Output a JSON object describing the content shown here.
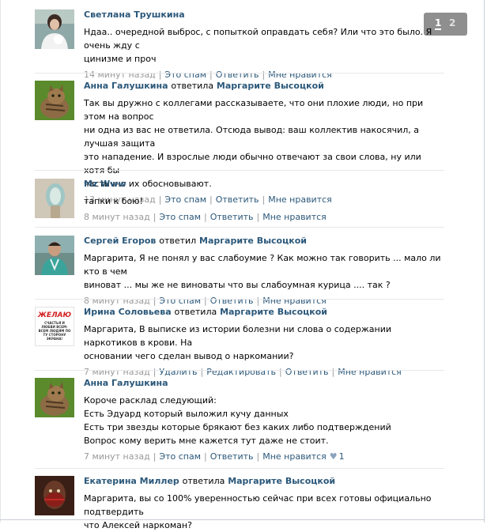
{
  "pagination": {
    "pages": [
      "1",
      "2"
    ],
    "current": "1"
  },
  "meta_links": {
    "spam": "Это спам",
    "reply": "Ответить",
    "like": "Мне нравится",
    "delete": "Удалить",
    "edit": "Редактировать"
  },
  "comments": [
    {
      "author": "Светлана Трушкина",
      "verb": "",
      "target": "",
      "lines": [
        "Ндаа.. очередной выброс, с попыткой оправдать себя? Или что это было. Я очень жду с",
        "цинизме и проч"
      ],
      "time": "14 минут назад",
      "likes": ""
    },
    {
      "author": "Анна Галушкина",
      "verb": "ответила",
      "target": "Маргарите Высоцкой",
      "lines": [
        "Так вы дружно с коллегами рассказываете, что они плохие люди, но при этом на вопрос",
        "ни одна из вас не ответила. Отсюда вывод: ваш коллектив накосячил, а лучшая защита",
        "это нападение. И взрослые люди обычно отвечают за свои слова, ну или хотя бы",
        "частично их обосновывают."
      ],
      "time": "13 минут назад",
      "likes": ""
    },
    {
      "author": "Mz Www",
      "verb": "",
      "target": "",
      "lines": [
        "тапки к бою!"
      ],
      "time": "8 минут назад",
      "likes": ""
    },
    {
      "author": "Сергей Егоров",
      "verb": "ответил",
      "target": "Маргарите Высоцкой",
      "lines": [
        "Маргарита, Я не понял у вас слабоумие ? Как можно так говорить ... мало ли кто в чем",
        "виноват ... мы же не виноваты что вы слабоумная курица .... так ?"
      ],
      "time": "8 минут назад",
      "likes": ""
    },
    {
      "author": "Ирина Соловьева",
      "verb": "ответила",
      "target": "Маргарите Высоцкой",
      "lines": [
        "Маргарита, В выписке из истории болезни ни слова о содержании наркотиков в крови. На",
        "основании чего сделан вывод о наркомании?"
      ],
      "time": "7 минут назад",
      "likes": "",
      "avatar_text": {
        "big": "ЖЕЛАЮ",
        "small": "СЧАСТЬЯ И ЛЮБВИ ВСЕМ-ВСЕМ ЛЮДЯМ ПО ТУ СТОРОНУ ЭКРАНА!"
      }
    },
    {
      "author": "Анна Галушкина",
      "verb": "",
      "target": "",
      "lines": [
        "Короче расклад следующий:",
        "Есть Эдуард который выложил кучу данных",
        "Есть три звезды которые брякают без каких либо подтверждений",
        "Вопрос кому верить мне кажется тут даже не стоит."
      ],
      "time": "7 минут назад",
      "likes": "1"
    },
    {
      "author": "Екатерина Миллер",
      "verb": "ответила",
      "target": "Маргарите Высоцкой",
      "lines": [
        "Маргарита, вы со 100% уверенностью сейчас при всех готовы официально подтвердить",
        "что Алексей наркоман?"
      ],
      "time": "",
      "likes": ""
    }
  ],
  "colors": {
    "link": "#2b587a",
    "meta": "#999999",
    "separator": "#e7e8ec",
    "pager": "#8f8f8f"
  }
}
